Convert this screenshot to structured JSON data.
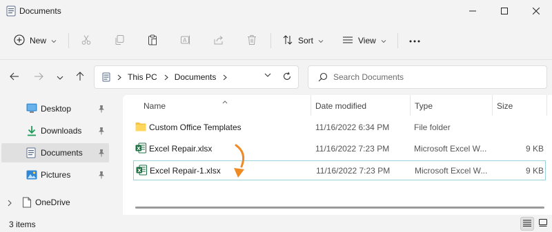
{
  "window": {
    "title": "Documents",
    "controls": [
      "minimize",
      "maximize",
      "close"
    ]
  },
  "toolbar": {
    "new_label": "New",
    "sort_label": "Sort",
    "view_label": "View",
    "icons": [
      "cut-icon",
      "copy-icon",
      "paste-icon",
      "rename-icon",
      "share-icon",
      "delete-icon"
    ],
    "more_label": "..."
  },
  "nav": {
    "breadcrumb": [
      "This PC",
      "Documents"
    ],
    "search_placeholder": "Search Documents"
  },
  "sidebar": {
    "items": [
      {
        "label": "Desktop",
        "icon": "desktop-icon",
        "pinned": true
      },
      {
        "label": "Downloads",
        "icon": "downloads-icon",
        "pinned": true
      },
      {
        "label": "Documents",
        "icon": "documents-icon",
        "pinned": true,
        "selected": true
      },
      {
        "label": "Pictures",
        "icon": "pictures-icon",
        "pinned": true
      },
      {
        "label": "OneDrive",
        "icon": "onedrive-icon",
        "pinned": false
      }
    ]
  },
  "columns": [
    "Name",
    "Date modified",
    "Type",
    "Size"
  ],
  "files": [
    {
      "name": "Custom Office Templates",
      "date": "11/16/2022 6:34 PM",
      "type": "File folder",
      "size": "",
      "icon": "folder-icon"
    },
    {
      "name": "Excel Repair.xlsx",
      "date": "11/16/2022 7:23 PM",
      "type": "Microsoft Excel W...",
      "size": "9 KB",
      "icon": "excel-icon"
    },
    {
      "name": "Excel Repair-1.xlsx",
      "date": "11/16/2022 7:23 PM",
      "type": "Microsoft Excel W...",
      "size": "9 KB",
      "icon": "excel-icon",
      "focused": true
    }
  ],
  "status": {
    "item_count": "3 items"
  },
  "colors": {
    "window_bg": "#f3f3f3",
    "content_bg": "#ffffff",
    "selected_bg": "#e0e0e0",
    "focus_border": "#99d1d8",
    "excel_green": "#1d6f42",
    "folder_yellow": "#f5c342",
    "annotation_arrow": "#f08a24"
  }
}
